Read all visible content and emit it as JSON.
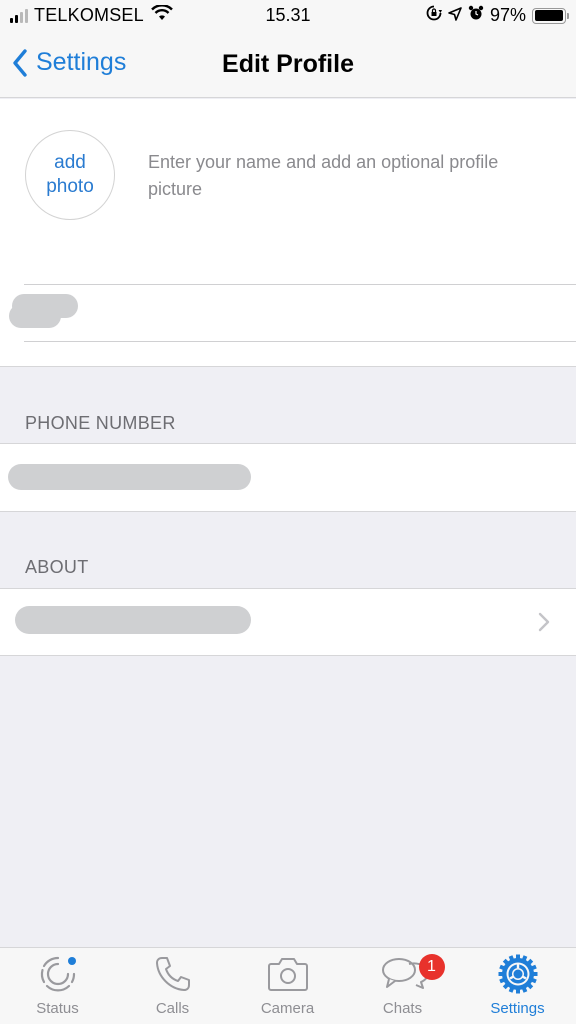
{
  "status_bar": {
    "carrier": "TELKOMSEL",
    "time": "15.31",
    "battery_percent_label": "97%",
    "battery_level": 0.97,
    "signal_bars_active": 2,
    "signal_bars_total": 4,
    "icons": [
      "signal-icon",
      "wifi-icon",
      "orientation-lock-icon",
      "location-icon",
      "alarm-icon",
      "battery-icon"
    ]
  },
  "nav": {
    "back_label": "Settings",
    "title": "Edit Profile"
  },
  "profile": {
    "add_photo_line1": "add",
    "add_photo_line2": "photo",
    "hint": "Enter your name and add an optional profile picture",
    "name_value": "[redacted]"
  },
  "phone_section": {
    "header": "PHONE NUMBER",
    "value": "[redacted]"
  },
  "about_section": {
    "header": "ABOUT",
    "value": "[redacted]"
  },
  "tabs": [
    {
      "label": "Status",
      "icon": "status-icon",
      "active": false,
      "has_dot": true
    },
    {
      "label": "Calls",
      "icon": "phone-icon",
      "active": false
    },
    {
      "label": "Camera",
      "icon": "camera-icon",
      "active": false
    },
    {
      "label": "Chats",
      "icon": "chats-icon",
      "active": false,
      "badge": "1"
    },
    {
      "label": "Settings",
      "icon": "settings-icon",
      "active": true
    }
  ],
  "colors": {
    "accent": "#1f7ed8",
    "badge": "#e8322c",
    "background": "#efeff4",
    "redaction": "#cfd0d2"
  }
}
